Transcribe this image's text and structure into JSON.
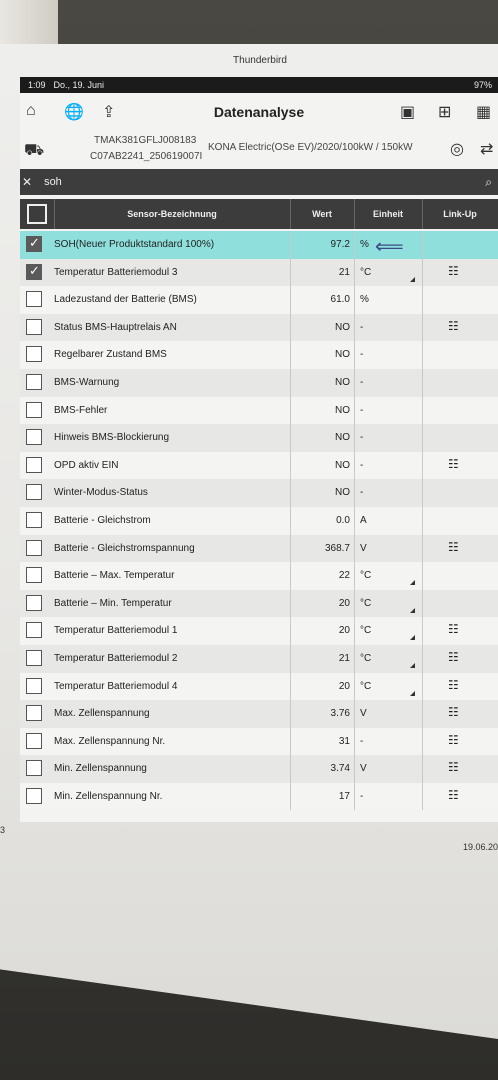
{
  "header": {
    "app": "Thunderbird",
    "page_number": "3",
    "date": "19.06.20"
  },
  "status": {
    "time": "1:09",
    "date": "Do., 19. Juni",
    "battery": "97%"
  },
  "app": {
    "title": "Datenanalyse"
  },
  "vehicle": {
    "vin": "TMAK381GFLJ008183",
    "id": "C07AB2241_250619007I",
    "model": "KONA Electric(OSe EV)/2020/100kW / 150kW"
  },
  "search": {
    "query": "soh"
  },
  "columns": {
    "sensor": "Sensor-Bezeichnung",
    "value": "Wert",
    "unit": "Einheit",
    "link": "Link-Up"
  },
  "rows": [
    {
      "name": "SOH(Neuer Produktstandard 100%)",
      "value": "97.2",
      "unit": "%",
      "checked": true,
      "highlight": true
    },
    {
      "name": "Temperatur Batteriemodul 3",
      "value": "21",
      "unit": "°C",
      "checked": true,
      "link": true,
      "tri": true
    },
    {
      "name": "Ladezustand der Batterie (BMS)",
      "value": "61.0",
      "unit": "%"
    },
    {
      "name": "Status BMS-Hauptrelais AN",
      "value": "NO",
      "unit": "-",
      "link": true
    },
    {
      "name": "Regelbarer Zustand BMS",
      "value": "NO",
      "unit": "-"
    },
    {
      "name": "BMS-Warnung",
      "value": "NO",
      "unit": "-"
    },
    {
      "name": "BMS-Fehler",
      "value": "NO",
      "unit": "-"
    },
    {
      "name": "Hinweis BMS-Blockierung",
      "value": "NO",
      "unit": "-"
    },
    {
      "name": "OPD aktiv EIN",
      "value": "NO",
      "unit": "-",
      "link": true
    },
    {
      "name": "Winter-Modus-Status",
      "value": "NO",
      "unit": "-"
    },
    {
      "name": "Batterie - Gleichstrom",
      "value": "0.0",
      "unit": "A"
    },
    {
      "name": "Batterie - Gleichstromspannung",
      "value": "368.7",
      "unit": "V",
      "link": true
    },
    {
      "name": "Batterie – Max. Temperatur",
      "value": "22",
      "unit": "°C",
      "tri": true
    },
    {
      "name": "Batterie – Min. Temperatur",
      "value": "20",
      "unit": "°C",
      "tri": true
    },
    {
      "name": "Temperatur Batteriemodul 1",
      "value": "20",
      "unit": "°C",
      "link": true,
      "tri": true
    },
    {
      "name": "Temperatur Batteriemodul 2",
      "value": "21",
      "unit": "°C",
      "link": true,
      "tri": true
    },
    {
      "name": "Temperatur Batteriemodul 4",
      "value": "20",
      "unit": "°C",
      "link": true,
      "tri": true
    },
    {
      "name": "Max. Zellenspannung",
      "value": "3.76",
      "unit": "V",
      "link": true
    },
    {
      "name": "Max. Zellenspannung Nr.",
      "value": "31",
      "unit": "-",
      "link": true
    },
    {
      "name": "Min. Zellenspannung",
      "value": "3.74",
      "unit": "V",
      "link": true
    },
    {
      "name": "Min. Zellenspannung Nr.",
      "value": "17",
      "unit": "-",
      "link": true
    }
  ]
}
